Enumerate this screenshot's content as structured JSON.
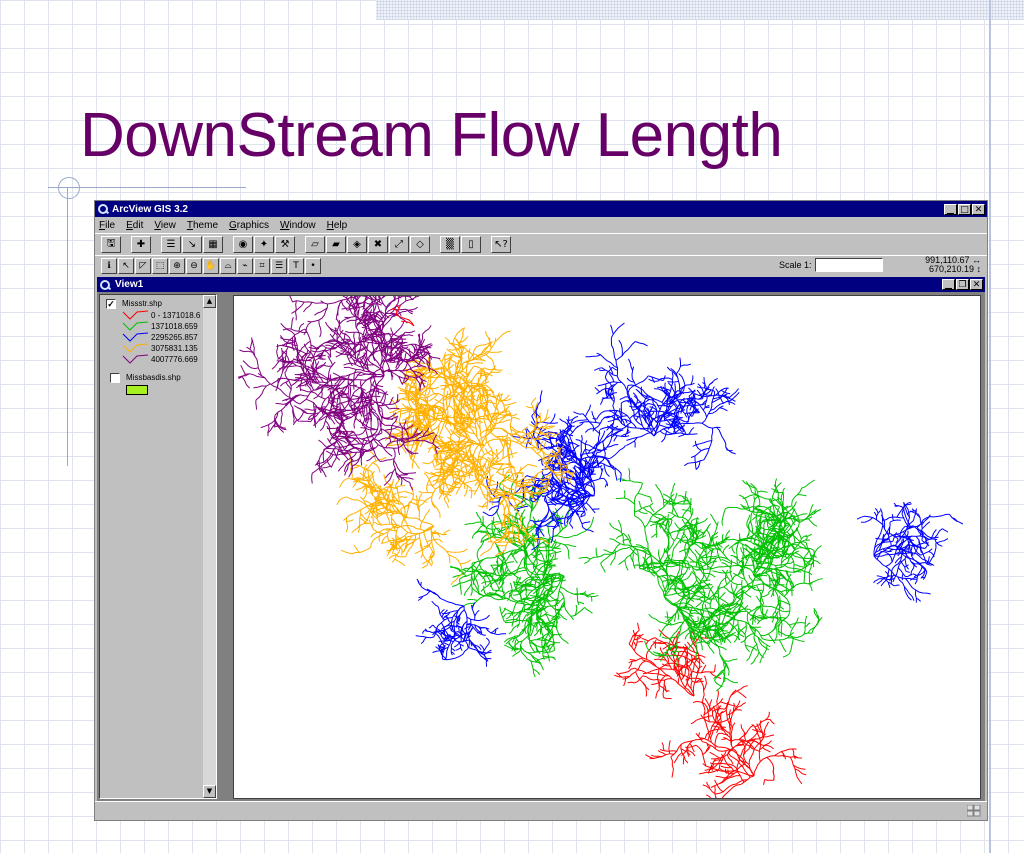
{
  "slide": {
    "title": "DownStream Flow Length"
  },
  "app": {
    "title": "ArcView GIS 3.2",
    "menu": [
      "File",
      "Edit",
      "View",
      "Theme",
      "Graphics",
      "Window",
      "Help"
    ],
    "toolbar1": [
      "save-icon",
      "add-theme-icon",
      "theme-properties-icon",
      "edit-legend-icon",
      "open-table-icon",
      "find-icon",
      "locate-icon",
      "query-builder-icon",
      "zoom-full-icon",
      "zoom-active-icon",
      "zoom-selected-icon",
      "zoom-in-icon",
      "zoom-out-icon",
      "zoom-previous-icon",
      "select-features-icon",
      "clear-selected-icon",
      "help-icon"
    ],
    "toolbar2": [
      "identify-icon",
      "pointer-icon",
      "vertex-edit-icon",
      "select-feature-icon",
      "zoom-in-tool-icon",
      "zoom-out-tool-icon",
      "pan-icon",
      "measure-icon",
      "hot-link-icon",
      "area-of-interest-icon",
      "label-icon",
      "text-icon",
      "draw-point-icon"
    ],
    "scale_label": "Scale 1:",
    "scale_value": "",
    "coord_x": "991,110.67",
    "coord_y": "670,210.19"
  },
  "view": {
    "title": "View1",
    "layers": [
      {
        "name": "Missstr.shp",
        "checked": true,
        "legend": [
          {
            "label": "0 - 1371018.6",
            "color": "#ff0000"
          },
          {
            "label": "1371018.659",
            "color": "#00c000"
          },
          {
            "label": "2295265.857",
            "color": "#0000ff"
          },
          {
            "label": "3075831.135",
            "color": "#ffb000"
          },
          {
            "label": "4007776.669",
            "color": "#800080"
          }
        ]
      },
      {
        "name": "Missbasdis.shp",
        "checked": false,
        "fill": "#a6f020"
      }
    ]
  },
  "colors": {
    "title": "#660066",
    "titlebar": "#000080",
    "chrome": "#c0c0c0"
  }
}
